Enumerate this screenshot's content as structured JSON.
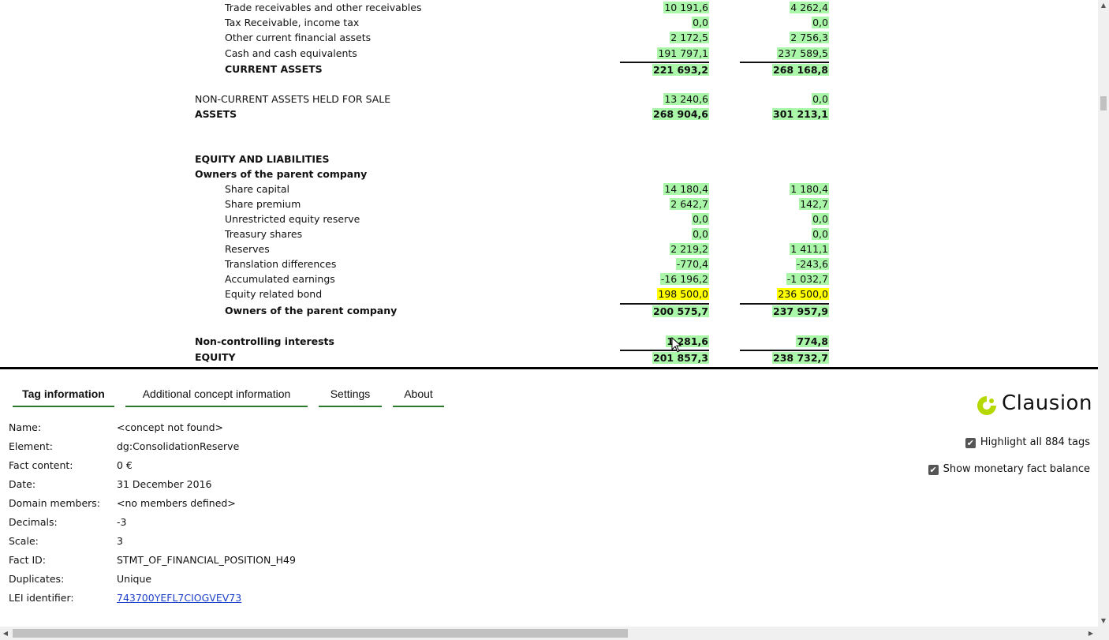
{
  "statement": {
    "rows": [
      {
        "label": "Trade receivables and other receivables",
        "indent": 1,
        "bold": false,
        "v1": "10 191,6",
        "v2": "4 262,4",
        "hl": "g"
      },
      {
        "label": "Tax Receivable, income tax",
        "indent": 1,
        "bold": false,
        "v1": "0,0",
        "v2": "0,0",
        "hl": "g"
      },
      {
        "label": "Other current financial assets",
        "indent": 1,
        "bold": false,
        "v1": "2 172,5",
        "v2": "2 756,3",
        "hl": "g"
      },
      {
        "label": "Cash and cash equivalents",
        "indent": 1,
        "bold": false,
        "v1": "191 797,1",
        "v2": "237 589,5",
        "hl": "g"
      },
      {
        "label": "CURRENT ASSETS",
        "indent": 1,
        "bold": true,
        "v1": "221 693,2",
        "v2": "268 168,8",
        "hl": "g",
        "sum": true
      },
      {
        "label": "NON-CURRENT ASSETS HELD FOR SALE",
        "indent": 0,
        "bold": false,
        "v1": "13 240,6",
        "v2": "0,0",
        "hl": "g"
      },
      {
        "label": "ASSETS",
        "indent": 0,
        "bold": true,
        "v1": "268 904,6",
        "v2": "301 213,1",
        "hl": "g"
      },
      {
        "label": "EQUITY AND LIABILITIES",
        "indent": 0,
        "bold": true
      },
      {
        "label": "Owners of the parent company",
        "indent": 0,
        "bold": true
      },
      {
        "label": "Share capital",
        "indent": 1,
        "bold": false,
        "v1": "14 180,4",
        "v2": "1 180,4",
        "hl": "g"
      },
      {
        "label": "Share premium",
        "indent": 1,
        "bold": false,
        "v1": "2 642,7",
        "v2": "142,7",
        "hl": "g"
      },
      {
        "label": "Unrestricted equity reserve",
        "indent": 1,
        "bold": false,
        "v1": "0,0",
        "v2": "0,0",
        "hl": "g"
      },
      {
        "label": "Treasury shares",
        "indent": 1,
        "bold": false,
        "v1": "0,0",
        "v2": "0,0",
        "hl": "g"
      },
      {
        "label": "Reserves",
        "indent": 1,
        "bold": false,
        "v1": "2 219,2",
        "v2": "1 411,1",
        "hl": "g"
      },
      {
        "label": "Translation differences",
        "indent": 1,
        "bold": false,
        "v1": "-770,4",
        "v2": "-243,6",
        "hl": "g"
      },
      {
        "label": "Accumulated earnings",
        "indent": 1,
        "bold": false,
        "v1": "-16 196,2",
        "v2": "-1 032,7",
        "hl": "g"
      },
      {
        "label": "Equity related bond",
        "indent": 1,
        "bold": false,
        "v1": "198 500,0",
        "v2": "236 500,0",
        "hl": "y"
      },
      {
        "label": "Owners of the parent company",
        "indent": 1,
        "bold": true,
        "v1": "200 575,7",
        "v2": "237 957,9",
        "hl": "g",
        "sum": true
      },
      {
        "label": "Non-controlling interests",
        "indent": 0,
        "bold": true,
        "v1": "1 281,6",
        "v2": "774,8",
        "hl": "g"
      },
      {
        "label": "EQUITY",
        "indent": 0,
        "bold": true,
        "v1": "201 857,3",
        "v2": "238 732,7",
        "hl": "g",
        "sum": true
      }
    ]
  },
  "tabs": [
    {
      "label": "Tag information",
      "active": true
    },
    {
      "label": "Additional concept information",
      "active": false
    },
    {
      "label": "Settings",
      "active": false
    },
    {
      "label": "About",
      "active": false
    }
  ],
  "tag_info": [
    {
      "key": "Name:",
      "value": "<concept not found>"
    },
    {
      "key": "Element:",
      "value": "dg:ConsolidationReserve"
    },
    {
      "key": "Fact content:",
      "value": "0 €"
    },
    {
      "key": "Date:",
      "value": "31 December 2016"
    },
    {
      "key": "Domain members:",
      "value": "<no members defined>"
    },
    {
      "key": "Decimals:",
      "value": "-3"
    },
    {
      "key": "Scale:",
      "value": "3"
    },
    {
      "key": "Fact ID:",
      "value": "STMT_OF_FINANCIAL_POSITION_H49"
    },
    {
      "key": "Duplicates:",
      "value": "Unique"
    },
    {
      "key": "LEI identifier:",
      "value": "743700YEFL7CIOGVEV73",
      "link": true
    }
  ],
  "logo": {
    "text": "Clausion",
    "mark_color": "#b5d800"
  },
  "options": {
    "highlight_label": "Highlight all 884 tags",
    "highlight_checked": true,
    "balance_label": "Show monetary fact balance",
    "balance_checked": true
  },
  "colors": {
    "highlight_green": "#aaf7aa",
    "highlight_yellow": "#ffff00",
    "tab_underline": "#2b7a2b",
    "link": "#1a3fc9"
  }
}
